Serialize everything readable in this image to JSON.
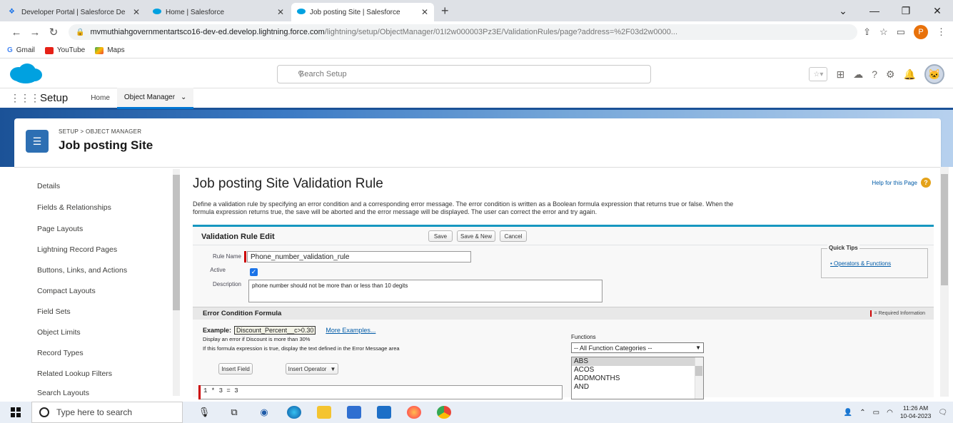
{
  "browser": {
    "tabs": [
      {
        "label": "Developer Portal | Salesforce De",
        "active": false
      },
      {
        "label": "Home | Salesforce",
        "active": false
      },
      {
        "label": "Job posting Site | Salesforce",
        "active": true
      }
    ],
    "url_host": "mvmuthiahgovernmentartsco16-dev-ed.develop.lightning.force.com",
    "url_path": "/lightning/setup/ObjectManager/01I2w000003Pz3E/ValidationRules/page?address=%2F03d2w0000...",
    "bookmarks": [
      "Gmail",
      "YouTube",
      "Maps"
    ],
    "profile_initial": "P"
  },
  "sf": {
    "search_placeholder": "Search Setup",
    "app_name": "Setup",
    "nav": {
      "home": "Home",
      "object_manager": "Object Manager"
    },
    "breadcrumb": "SETUP > OBJECT MANAGER",
    "object_title": "Job posting Site"
  },
  "sidebar": {
    "items": [
      "Details",
      "Fields & Relationships",
      "Page Layouts",
      "Lightning Record Pages",
      "Buttons, Links, and Actions",
      "Compact Layouts",
      "Field Sets",
      "Object Limits",
      "Record Types",
      "Related Lookup Filters",
      "Search Layouts"
    ]
  },
  "main": {
    "page_title": "Job posting Site Validation Rule",
    "help_link": "Help for this Page",
    "intro_line1": "Define a validation rule by specifying an error condition and a corresponding error message. The error condition is written as a Boolean formula expression that returns true or false. When the",
    "intro_line2": "formula expression returns true, the save will be aborted and the error message will be displayed. The user can correct the error and try again.",
    "edit_title": "Validation Rule Edit",
    "buttons": {
      "save": "Save",
      "save_new": "Save & New",
      "cancel": "Cancel"
    },
    "labels": {
      "rule_name": "Rule Name",
      "active": "Active",
      "description": "Description"
    },
    "rule_name_value": "Phone_number_validation_rule",
    "description_value": "phone number should not be more than or less than 10 degits",
    "quick_tips": {
      "title": "Quick Tips",
      "link": "Operators & Functions"
    },
    "error_section": {
      "title": "Error Condition Formula",
      "required_legend": "= Required Information",
      "example_label": "Example:",
      "example_value": "Discount_Percent__c>0.30",
      "more_examples": "More Examples...",
      "example_desc": "Display an error if Discount is more than 30%",
      "formula_desc": "If this formula expression is true, display the text defined in the Error Message area",
      "insert_field": "Insert Field",
      "insert_operator": "Insert Operator",
      "functions_label": "Functions",
      "functions_select": "-- All Function Categories --",
      "functions_list": [
        "ABS",
        "ACOS",
        "ADDMONTHS",
        "AND"
      ],
      "formula_value": "1 * 3 = 3"
    }
  },
  "taskbar": {
    "search_placeholder": "Type here to search",
    "time": "11:26 AM",
    "date": "10-04-2023"
  },
  "colors": {
    "sf_blue": "#1b5297",
    "accent": "#0176d3",
    "required": "#cc0000"
  }
}
